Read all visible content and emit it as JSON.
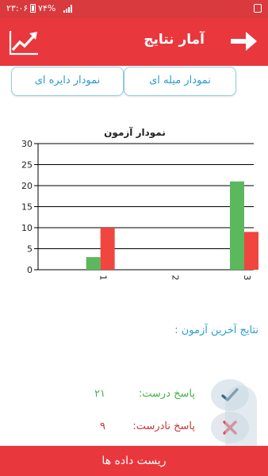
{
  "status": {
    "time": "۲۳:۰۶",
    "battery": "۷۴%"
  },
  "header": {
    "title": "آمار نتایج"
  },
  "tabs": {
    "bar": "نمودار میله ای",
    "pie": "نمودار دایره ای"
  },
  "chart_data": {
    "type": "bar",
    "title": "نمودار آزمون",
    "categories": [
      "1",
      "2",
      "3"
    ],
    "series": [
      {
        "color": "#5cb85c",
        "values": [
          3,
          0,
          21
        ]
      },
      {
        "color": "#f0463f",
        "values": [
          10,
          0,
          9
        ]
      }
    ],
    "ylim": [
      0,
      30
    ],
    "yticks": [
      0,
      5,
      10,
      15,
      20,
      25,
      30
    ],
    "grid": true
  },
  "results": {
    "title": "نتایج آخرین آزمون :",
    "correct_label": "پاسخ درست:",
    "correct_value": "۲۱",
    "wrong_label": "پاسخ نادرست:",
    "wrong_value": "۹"
  },
  "footer": {
    "reset_label": "ریست داده ها"
  },
  "colors": {
    "primary": "#e8373d",
    "accent": "#2aa0cf",
    "correct": "#45b34e",
    "wrong": "#c8383c"
  }
}
